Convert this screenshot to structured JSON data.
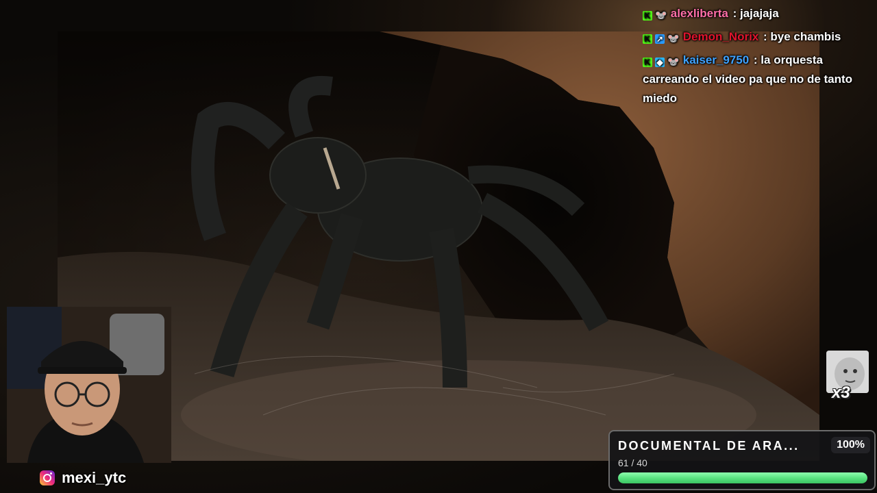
{
  "chat": {
    "messages": [
      {
        "badges": [
          "kick-badge",
          "mouse-badge"
        ],
        "username": "alexliberta",
        "color": "#ff6fa8",
        "text": ": jajajaja"
      },
      {
        "badges": [
          "kick-badge",
          "blue-badge",
          "mouse-badge"
        ],
        "username": "Demon_Norix",
        "color": "#e0142d",
        "text": ": bye chambis"
      },
      {
        "badges": [
          "kick-badge",
          "cube-badge",
          "mouse-badge"
        ],
        "username": "kaiser_9750",
        "color": "#3fa2ff",
        "text": ": la orquesta carreando el video pa que no de tanto miedo"
      }
    ]
  },
  "streamer": {
    "instagram_handle": "mexi_ytc"
  },
  "sticker": {
    "count": "x3"
  },
  "goal": {
    "title": "DOCUMENTAL DE ARA...",
    "percent": "100%",
    "count_text": "61 / 40",
    "progress": 1.0,
    "color": "#56e07d"
  }
}
